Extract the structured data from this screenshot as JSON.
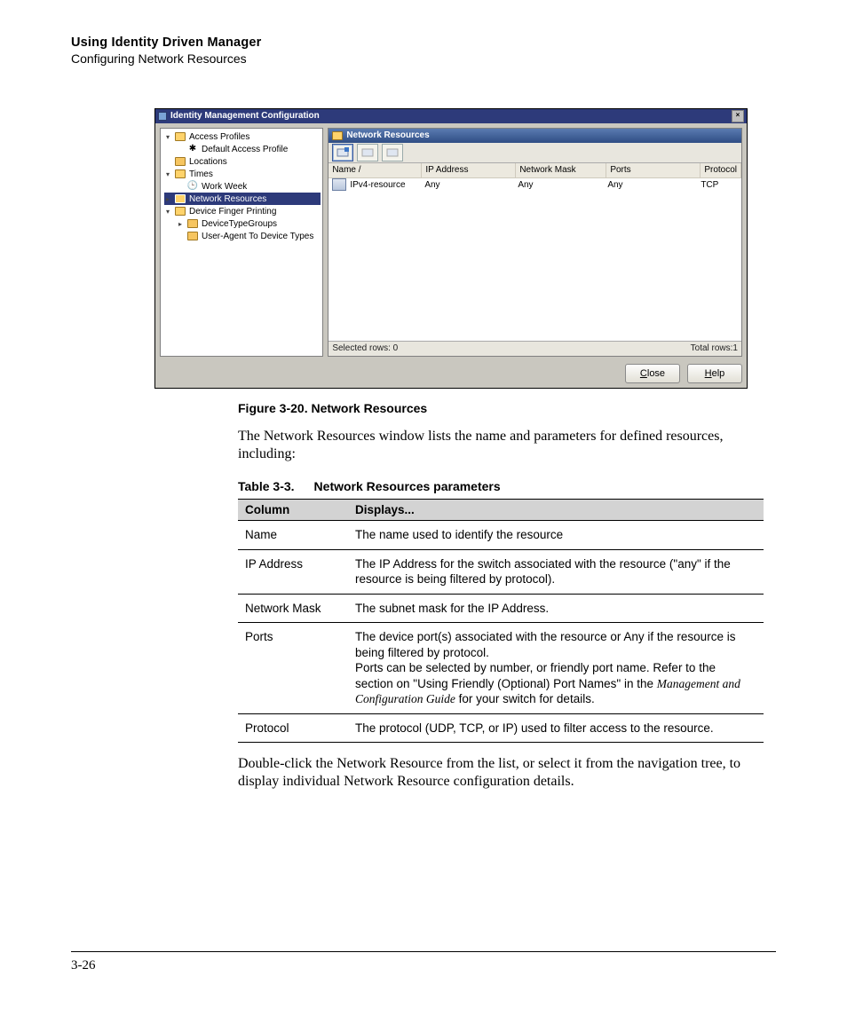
{
  "header": {
    "title": "Using Identity Driven Manager",
    "subtitle": "Configuring Network Resources"
  },
  "window": {
    "title": "Identity Management Configuration",
    "close_label": "×",
    "right": {
      "header_label": "Network Resources",
      "columns": {
        "name": "Name  /",
        "ip": "IP Address",
        "mask": "Network Mask",
        "ports": "Ports",
        "proto": "Protocol"
      },
      "rows": [
        {
          "name": "IPv4-resource",
          "ip": "Any",
          "mask": "Any",
          "ports": "Any",
          "proto": "TCP"
        }
      ],
      "status": {
        "selected": "Selected rows: 0",
        "total": "Total rows:1"
      }
    },
    "tree": {
      "access_profiles": "Access Profiles",
      "default_access_profile": "Default Access Profile",
      "locations": "Locations",
      "times": "Times",
      "work_week": "Work Week",
      "network_resources": "Network Resources",
      "device_finger_printing": "Device Finger Printing",
      "device_type_groups": "DeviceTypeGroups",
      "user_agent_to_device_types": "User-Agent To Device Types"
    },
    "buttons": {
      "close": "Close",
      "close_u": "C",
      "help": "Help",
      "help_u": "H"
    }
  },
  "figure_caption": "Figure 3-20. Network Resources",
  "para1": "The Network Resources window lists the name and parameters for defined resources, including:",
  "table_caption_a": "Table 3-3.",
  "table_caption_b": "Network Resources parameters",
  "table": {
    "head_a": "Column",
    "head_b": "Displays...",
    "rows": {
      "name": {
        "c": "Name",
        "d": "The name used to identify the resource"
      },
      "ip": {
        "c": "IP Address",
        "d": "The IP Address for the switch associated with the resource (\"any\" if the resource is being filtered by protocol)."
      },
      "mask": {
        "c": "Network Mask",
        "d": "The subnet mask for the IP Address."
      },
      "ports": {
        "c": "Ports",
        "d1": "The device port(s) associated with the resource or Any if the resource is being filtered by protocol.",
        "d2a": "Ports can be selected by number, or friendly port name. Refer to the section on \"Using Friendly (Optional) Port Names\" in the ",
        "d2i": "Management and Configuration Guide",
        "d2b": " for your switch for details."
      },
      "proto": {
        "c": "Protocol",
        "d": "The protocol (UDP, TCP, or IP) used to filter access to the resource."
      }
    }
  },
  "para2": "Double-click the Network Resource from the list, or select it from the navigation tree, to display individual Network Resource configuration details.",
  "page_number": "3-26"
}
